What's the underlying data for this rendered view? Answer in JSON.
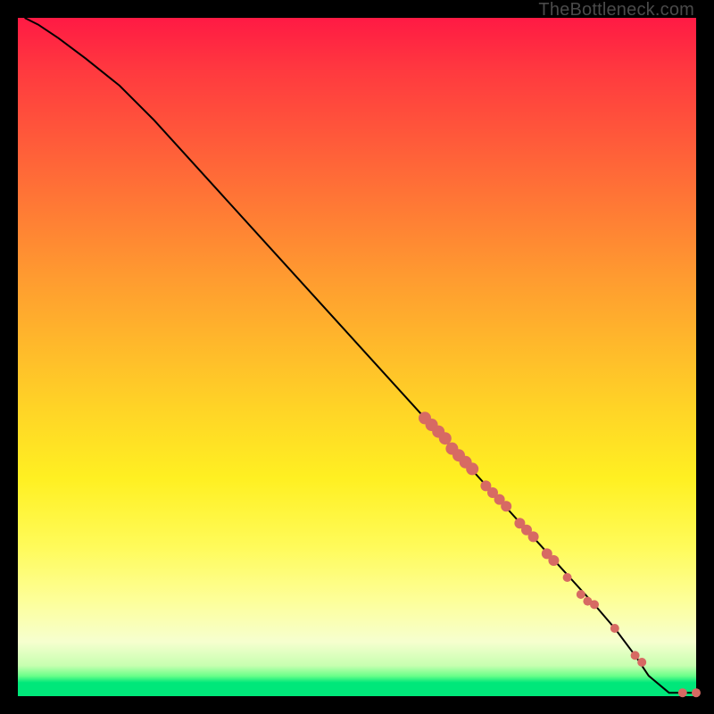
{
  "watermark": "TheBottleneck.com",
  "colors": {
    "marker": "#d76a63",
    "curve": "#000000",
    "background": "#000000"
  },
  "chart_data": {
    "type": "line",
    "title": "",
    "xlabel": "",
    "ylabel": "",
    "xlim": [
      0,
      100
    ],
    "ylim": [
      0,
      100
    ],
    "grid": false,
    "legend": false,
    "notes": "Axes are unlabeled in the source image; x and y are treated as 0–100 percentage scales. Curve starts near (1,100) and descends roughly linearly to (~93,0) with a small flat tail to (100,0). Markers cluster along the lower-right portion of the curve.",
    "series": [
      {
        "name": "curve",
        "kind": "line",
        "x": [
          1,
          3,
          6,
          10,
          15,
          20,
          30,
          40,
          50,
          60,
          65,
          70,
          75,
          80,
          85,
          88,
          91,
          93,
          96,
          100
        ],
        "y": [
          100,
          99,
          97,
          94,
          90,
          85,
          74,
          63,
          52,
          41,
          35.5,
          30,
          24.5,
          19,
          13.5,
          10,
          6,
          3,
          0.5,
          0.5
        ]
      },
      {
        "name": "markers",
        "kind": "scatter",
        "x": [
          60,
          61,
          62,
          63,
          64,
          65,
          66,
          67,
          69,
          70,
          71,
          72,
          74,
          75,
          76,
          78,
          79,
          81,
          83,
          84,
          85,
          88,
          91,
          92,
          98,
          100
        ],
        "y": [
          41,
          40,
          39,
          38,
          36.5,
          35.5,
          34.5,
          33.5,
          31,
          30,
          29,
          28,
          25.5,
          24.5,
          23.5,
          21,
          20,
          17.5,
          15,
          14,
          13.5,
          10,
          6,
          5,
          0.5,
          0.5
        ],
        "r": [
          7,
          7,
          7,
          7,
          7,
          7,
          7,
          7,
          6,
          6,
          6,
          6,
          6,
          6,
          6,
          6,
          6,
          5,
          5,
          5,
          5,
          5,
          5,
          5,
          5,
          5
        ]
      }
    ]
  }
}
